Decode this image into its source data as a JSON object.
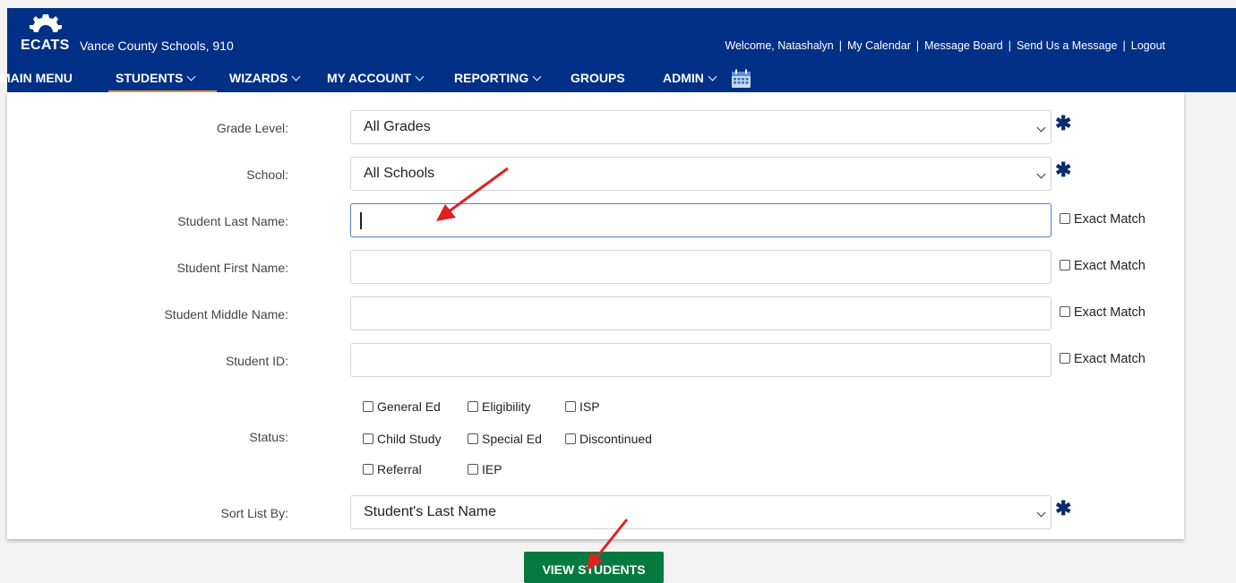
{
  "header": {
    "logo_text": "ECATS",
    "district": "Vance County Schools, 910",
    "welcome": "Welcome, Natashalyn",
    "links": [
      "My Calendar",
      "Message Board",
      "Send Us a Message",
      "Logout"
    ]
  },
  "nav": {
    "items": [
      {
        "label": "MAIN MENU",
        "has_dropdown": false
      },
      {
        "label": "STUDENTS",
        "has_dropdown": true,
        "active": true
      },
      {
        "label": "WIZARDS",
        "has_dropdown": true
      },
      {
        "label": "MY ACCOUNT",
        "has_dropdown": true
      },
      {
        "label": "REPORTING",
        "has_dropdown": true
      },
      {
        "label": "GROUPS",
        "has_dropdown": false
      },
      {
        "label": "ADMIN",
        "has_dropdown": true
      }
    ],
    "calendar_icon": "calendar-icon"
  },
  "form": {
    "grade_level": {
      "label": "Grade Level:",
      "value": "All Grades"
    },
    "school": {
      "label": "School:",
      "value": "All Schools"
    },
    "last_name": {
      "label": "Student Last Name:",
      "value": "",
      "exact_label": "Exact Match"
    },
    "first_name": {
      "label": "Student First Name:",
      "value": "",
      "exact_label": "Exact Match"
    },
    "middle_name": {
      "label": "Student Middle Name:",
      "value": "",
      "exact_label": "Exact Match"
    },
    "student_id": {
      "label": "Student ID:",
      "value": "",
      "exact_label": "Exact Match"
    },
    "status": {
      "label": "Status:",
      "options": [
        "General Ed",
        "Eligibility",
        "ISP",
        "Child Study",
        "Special Ed",
        "Discontinued",
        "Referral",
        "IEP"
      ]
    },
    "sort_by": {
      "label": "Sort List By:",
      "value": "Student's Last Name"
    },
    "required_mark": "✱"
  },
  "view_button": "VIEW STUDENTS",
  "colors": {
    "header_bg": "#013086",
    "nav_active_underline": "#f7941d",
    "button_bg": "#047a3f",
    "annotation_arrow": "#e02020"
  }
}
